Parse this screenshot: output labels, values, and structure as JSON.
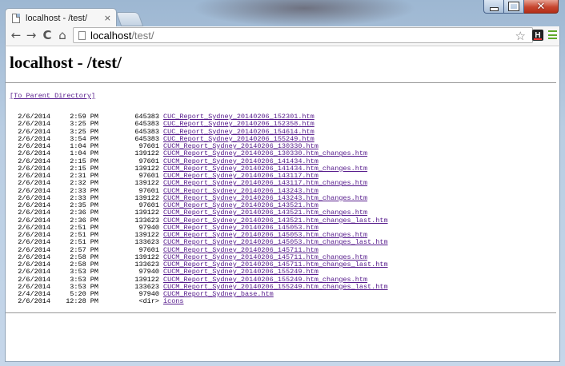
{
  "window": {
    "tab_title": "localhost - /test/",
    "tab_close": "×",
    "caption": {
      "minimize": "",
      "maximize": "",
      "close": "✕"
    }
  },
  "toolbar": {
    "back": "←",
    "forward": "→",
    "reload": "C",
    "home": "⌂",
    "url_host": "localhost",
    "url_path": "/test/",
    "star": "☆",
    "ext_label": "H"
  },
  "page": {
    "heading": "localhost - /test/",
    "parent_link": "[To Parent Directory]",
    "entries": [
      {
        "date": "2/6/2014",
        "time": "2:59 PM",
        "size": "645383",
        "name": "CUC_Report_Sydney_20140206_152301.htm"
      },
      {
        "date": "2/6/2014",
        "time": "3:25 PM",
        "size": "645383",
        "name": "CUC_Report_Sydney_20140206_152358.htm"
      },
      {
        "date": "2/6/2014",
        "time": "3:25 PM",
        "size": "645383",
        "name": "CUC_Report_Sydney_20140206_154614.htm"
      },
      {
        "date": "2/6/2014",
        "time": "3:54 PM",
        "size": "645383",
        "name": "CUC_Report_Sydney_20140206_155249.htm"
      },
      {
        "date": "2/6/2014",
        "time": "1:04 PM",
        "size": "97601",
        "name": "CUCM_Report_Sydney_20140206_130330.htm"
      },
      {
        "date": "2/6/2014",
        "time": "1:04 PM",
        "size": "139122",
        "name": "CUCM_Report_Sydney_20140206_130330.htm_changes.htm"
      },
      {
        "date": "2/6/2014",
        "time": "2:15 PM",
        "size": "97601",
        "name": "CUCM_Report_Sydney_20140206_141434.htm"
      },
      {
        "date": "2/6/2014",
        "time": "2:15 PM",
        "size": "139122",
        "name": "CUCM_Report_Sydney_20140206_141434.htm_changes.htm"
      },
      {
        "date": "2/6/2014",
        "time": "2:31 PM",
        "size": "97601",
        "name": "CUCM_Report_Sydney_20140206_143117.htm"
      },
      {
        "date": "2/6/2014",
        "time": "2:32 PM",
        "size": "139122",
        "name": "CUCM_Report_Sydney_20140206_143117.htm_changes.htm"
      },
      {
        "date": "2/6/2014",
        "time": "2:33 PM",
        "size": "97601",
        "name": "CUCM_Report_Sydney_20140206_143243.htm"
      },
      {
        "date": "2/6/2014",
        "time": "2:33 PM",
        "size": "139122",
        "name": "CUCM_Report_Sydney_20140206_143243.htm_changes.htm"
      },
      {
        "date": "2/6/2014",
        "time": "2:35 PM",
        "size": "97601",
        "name": "CUCM_Report_Sydney_20140206_143521.htm"
      },
      {
        "date": "2/6/2014",
        "time": "2:36 PM",
        "size": "139122",
        "name": "CUCM_Report_Sydney_20140206_143521.htm_changes.htm"
      },
      {
        "date": "2/6/2014",
        "time": "2:36 PM",
        "size": "133623",
        "name": "CUCM_Report_Sydney_20140206_143521.htm_changes_last.htm"
      },
      {
        "date": "2/6/2014",
        "time": "2:51 PM",
        "size": "97940",
        "name": "CUCM_Report_Sydney_20140206_145053.htm"
      },
      {
        "date": "2/6/2014",
        "time": "2:51 PM",
        "size": "139122",
        "name": "CUCM_Report_Sydney_20140206_145053.htm_changes.htm"
      },
      {
        "date": "2/6/2014",
        "time": "2:51 PM",
        "size": "133623",
        "name": "CUCM_Report_Sydney_20140206_145053.htm_changes_last.htm"
      },
      {
        "date": "2/6/2014",
        "time": "2:57 PM",
        "size": "97601",
        "name": "CUCM_Report_Sydney_20140206_145711.htm"
      },
      {
        "date": "2/6/2014",
        "time": "2:58 PM",
        "size": "139122",
        "name": "CUCM_Report_Sydney_20140206_145711.htm_changes.htm"
      },
      {
        "date": "2/6/2014",
        "time": "2:58 PM",
        "size": "133623",
        "name": "CUCM_Report_Sydney_20140206_145711.htm_changes_last.htm"
      },
      {
        "date": "2/6/2014",
        "time": "3:53 PM",
        "size": "97940",
        "name": "CUCM_Report_Sydney_20140206_155249.htm"
      },
      {
        "date": "2/6/2014",
        "time": "3:53 PM",
        "size": "139122",
        "name": "CUCM_Report_Sydney_20140206_155249.htm_changes.htm"
      },
      {
        "date": "2/6/2014",
        "time": "3:53 PM",
        "size": "133623",
        "name": "CUCM_Report_Sydney_20140206_155249.htm_changes_last.htm"
      },
      {
        "date": "2/4/2014",
        "time": "5:20 PM",
        "size": "97940",
        "name": "CUCM_Report_Sydney_base.htm"
      },
      {
        "date": "2/6/2014",
        "time": "12:28 PM",
        "size": "<dir>",
        "name": "icons"
      }
    ]
  },
  "colors": {
    "visited_link": "#551a8b",
    "frame": "#b9cde2",
    "close_button": "#c7462f",
    "menu_icon": "#5fa928"
  }
}
